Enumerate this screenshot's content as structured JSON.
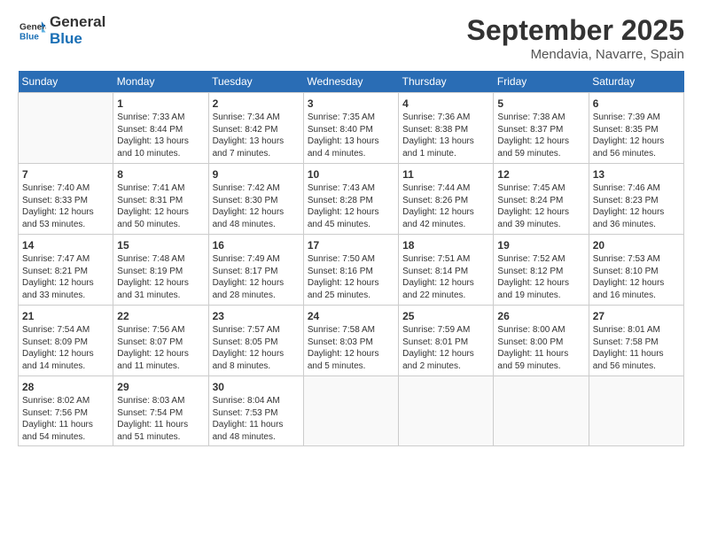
{
  "logo": {
    "line1": "General",
    "line2": "Blue"
  },
  "title": "September 2025",
  "location": "Mendavia, Navarre, Spain",
  "weekdays": [
    "Sunday",
    "Monday",
    "Tuesday",
    "Wednesday",
    "Thursday",
    "Friday",
    "Saturday"
  ],
  "weeks": [
    [
      {
        "day": "",
        "info": ""
      },
      {
        "day": "1",
        "info": "Sunrise: 7:33 AM\nSunset: 8:44 PM\nDaylight: 13 hours\nand 10 minutes."
      },
      {
        "day": "2",
        "info": "Sunrise: 7:34 AM\nSunset: 8:42 PM\nDaylight: 13 hours\nand 7 minutes."
      },
      {
        "day": "3",
        "info": "Sunrise: 7:35 AM\nSunset: 8:40 PM\nDaylight: 13 hours\nand 4 minutes."
      },
      {
        "day": "4",
        "info": "Sunrise: 7:36 AM\nSunset: 8:38 PM\nDaylight: 13 hours\nand 1 minute."
      },
      {
        "day": "5",
        "info": "Sunrise: 7:38 AM\nSunset: 8:37 PM\nDaylight: 12 hours\nand 59 minutes."
      },
      {
        "day": "6",
        "info": "Sunrise: 7:39 AM\nSunset: 8:35 PM\nDaylight: 12 hours\nand 56 minutes."
      }
    ],
    [
      {
        "day": "7",
        "info": "Sunrise: 7:40 AM\nSunset: 8:33 PM\nDaylight: 12 hours\nand 53 minutes."
      },
      {
        "day": "8",
        "info": "Sunrise: 7:41 AM\nSunset: 8:31 PM\nDaylight: 12 hours\nand 50 minutes."
      },
      {
        "day": "9",
        "info": "Sunrise: 7:42 AM\nSunset: 8:30 PM\nDaylight: 12 hours\nand 48 minutes."
      },
      {
        "day": "10",
        "info": "Sunrise: 7:43 AM\nSunset: 8:28 PM\nDaylight: 12 hours\nand 45 minutes."
      },
      {
        "day": "11",
        "info": "Sunrise: 7:44 AM\nSunset: 8:26 PM\nDaylight: 12 hours\nand 42 minutes."
      },
      {
        "day": "12",
        "info": "Sunrise: 7:45 AM\nSunset: 8:24 PM\nDaylight: 12 hours\nand 39 minutes."
      },
      {
        "day": "13",
        "info": "Sunrise: 7:46 AM\nSunset: 8:23 PM\nDaylight: 12 hours\nand 36 minutes."
      }
    ],
    [
      {
        "day": "14",
        "info": "Sunrise: 7:47 AM\nSunset: 8:21 PM\nDaylight: 12 hours\nand 33 minutes."
      },
      {
        "day": "15",
        "info": "Sunrise: 7:48 AM\nSunset: 8:19 PM\nDaylight: 12 hours\nand 31 minutes."
      },
      {
        "day": "16",
        "info": "Sunrise: 7:49 AM\nSunset: 8:17 PM\nDaylight: 12 hours\nand 28 minutes."
      },
      {
        "day": "17",
        "info": "Sunrise: 7:50 AM\nSunset: 8:16 PM\nDaylight: 12 hours\nand 25 minutes."
      },
      {
        "day": "18",
        "info": "Sunrise: 7:51 AM\nSunset: 8:14 PM\nDaylight: 12 hours\nand 22 minutes."
      },
      {
        "day": "19",
        "info": "Sunrise: 7:52 AM\nSunset: 8:12 PM\nDaylight: 12 hours\nand 19 minutes."
      },
      {
        "day": "20",
        "info": "Sunrise: 7:53 AM\nSunset: 8:10 PM\nDaylight: 12 hours\nand 16 minutes."
      }
    ],
    [
      {
        "day": "21",
        "info": "Sunrise: 7:54 AM\nSunset: 8:09 PM\nDaylight: 12 hours\nand 14 minutes."
      },
      {
        "day": "22",
        "info": "Sunrise: 7:56 AM\nSunset: 8:07 PM\nDaylight: 12 hours\nand 11 minutes."
      },
      {
        "day": "23",
        "info": "Sunrise: 7:57 AM\nSunset: 8:05 PM\nDaylight: 12 hours\nand 8 minutes."
      },
      {
        "day": "24",
        "info": "Sunrise: 7:58 AM\nSunset: 8:03 PM\nDaylight: 12 hours\nand 5 minutes."
      },
      {
        "day": "25",
        "info": "Sunrise: 7:59 AM\nSunset: 8:01 PM\nDaylight: 12 hours\nand 2 minutes."
      },
      {
        "day": "26",
        "info": "Sunrise: 8:00 AM\nSunset: 8:00 PM\nDaylight: 11 hours\nand 59 minutes."
      },
      {
        "day": "27",
        "info": "Sunrise: 8:01 AM\nSunset: 7:58 PM\nDaylight: 11 hours\nand 56 minutes."
      }
    ],
    [
      {
        "day": "28",
        "info": "Sunrise: 8:02 AM\nSunset: 7:56 PM\nDaylight: 11 hours\nand 54 minutes."
      },
      {
        "day": "29",
        "info": "Sunrise: 8:03 AM\nSunset: 7:54 PM\nDaylight: 11 hours\nand 51 minutes."
      },
      {
        "day": "30",
        "info": "Sunrise: 8:04 AM\nSunset: 7:53 PM\nDaylight: 11 hours\nand 48 minutes."
      },
      {
        "day": "",
        "info": ""
      },
      {
        "day": "",
        "info": ""
      },
      {
        "day": "",
        "info": ""
      },
      {
        "day": "",
        "info": ""
      }
    ]
  ]
}
